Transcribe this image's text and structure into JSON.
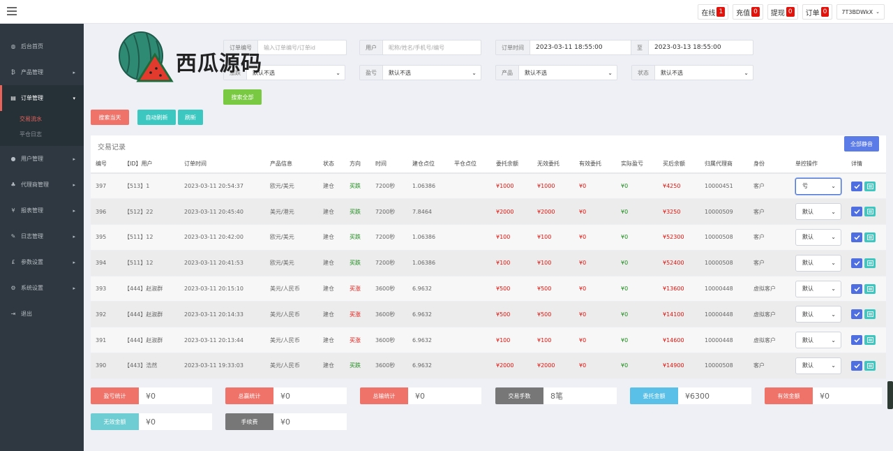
{
  "topbar": {
    "badges": [
      {
        "label": "在线",
        "count": "1"
      },
      {
        "label": "充值",
        "count": "0"
      },
      {
        "label": "提现",
        "count": "0"
      },
      {
        "label": "订单",
        "count": "0"
      }
    ],
    "user": "7T3BDWkX"
  },
  "sidebar": {
    "items": [
      {
        "label": "后台首页",
        "icon": "dashboard-icon",
        "glyph": "◍"
      },
      {
        "label": "产品管理",
        "icon": "bitcoin-icon",
        "glyph": "₿"
      },
      {
        "label": "订单管理",
        "icon": "order-icon",
        "glyph": "▤"
      },
      {
        "label": "用户管理",
        "icon": "user-icon",
        "glyph": "●"
      },
      {
        "label": "代理商管理",
        "icon": "sitemap-icon",
        "glyph": "♣"
      },
      {
        "label": "报表管理",
        "icon": "yen-icon",
        "glyph": "¥"
      },
      {
        "label": "日志管理",
        "icon": "log-icon",
        "glyph": "✎"
      },
      {
        "label": "参数设置",
        "icon": "pound-icon",
        "glyph": "£"
      },
      {
        "label": "系统设置",
        "icon": "gear-icon",
        "glyph": "⚙"
      },
      {
        "label": "退出",
        "icon": "logout-icon",
        "glyph": "⇥"
      }
    ],
    "subitems": [
      "交易流水",
      "平仓日志"
    ]
  },
  "logo": {
    "text": "西瓜源码"
  },
  "filters": {
    "order_no": {
      "label": "订单编号",
      "placeholder": "输入订单编号/订单id"
    },
    "user": {
      "label": "用户",
      "placeholder": "昵称/姓名/手机号/编号"
    },
    "order_time": {
      "label": "订单时间",
      "from": "2023-03-11 18:55:00",
      "to_label": "至",
      "to": "2023-03-13 18:55:00"
    },
    "rise_fall": {
      "label": "涨跌",
      "value": "默认不选"
    },
    "profit": {
      "label": "盈亏",
      "value": "默认不选"
    },
    "product": {
      "label": "产品",
      "value": "默认不选"
    },
    "status": {
      "label": "状态",
      "value": "默认不选"
    }
  },
  "buttons": {
    "search_all": "搜索全部",
    "search_today": "搜索当天",
    "auto_refresh": "自动刷新",
    "refresh": "刷新",
    "mute_all": "全部静音"
  },
  "table": {
    "title": "交易记录",
    "headers": [
      "编号",
      "【ID】用户",
      "订单时间",
      "产品信息",
      "状态",
      "方向",
      "时间",
      "建仓点位",
      "平仓点位",
      "委托余额",
      "无效委托",
      "有效委托",
      "实际盈亏",
      "买后余额",
      "归属代理商",
      "身份",
      "单控操作",
      "详情"
    ],
    "rows": [
      {
        "id": "397",
        "user": "【513】1",
        "time": "2023-03-11 20:54:37",
        "product": "欧元/美元",
        "status": "建仓",
        "direction": "买跌",
        "duration": "7200秒",
        "open": "1.06386",
        "close": "",
        "entrust": "¥1000",
        "invalid": "¥1000",
        "valid": "¥0",
        "pnl": "¥0",
        "balance": "¥4250",
        "agent": "10000451",
        "role": "客户",
        "control": "亏"
      },
      {
        "id": "396",
        "user": "【512】22",
        "time": "2023-03-11 20:45:40",
        "product": "美元/港元",
        "status": "建仓",
        "direction": "买跌",
        "duration": "7200秒",
        "open": "7.8464",
        "close": "",
        "entrust": "¥2000",
        "invalid": "¥2000",
        "valid": "¥0",
        "pnl": "¥0",
        "balance": "¥3250",
        "agent": "10000509",
        "role": "客户",
        "control": "默认"
      },
      {
        "id": "395",
        "user": "【511】12",
        "time": "2023-03-11 20:42:00",
        "product": "欧元/美元",
        "status": "建仓",
        "direction": "买跌",
        "duration": "7200秒",
        "open": "1.06386",
        "close": "",
        "entrust": "¥100",
        "invalid": "¥100",
        "valid": "¥0",
        "pnl": "¥0",
        "balance": "¥52300",
        "agent": "10000508",
        "role": "客户",
        "control": "默认"
      },
      {
        "id": "394",
        "user": "【511】12",
        "time": "2023-03-11 20:41:53",
        "product": "欧元/美元",
        "status": "建仓",
        "direction": "买跌",
        "duration": "7200秒",
        "open": "1.06386",
        "close": "",
        "entrust": "¥100",
        "invalid": "¥100",
        "valid": "¥0",
        "pnl": "¥0",
        "balance": "¥52400",
        "agent": "10000508",
        "role": "客户",
        "control": "默认"
      },
      {
        "id": "393",
        "user": "【444】赵淑群",
        "time": "2023-03-11 20:15:10",
        "product": "美元/人民币",
        "status": "建仓",
        "direction": "买涨",
        "duration": "3600秒",
        "open": "6.9632",
        "close": "",
        "entrust": "¥500",
        "invalid": "¥500",
        "valid": "¥0",
        "pnl": "¥0",
        "balance": "¥13600",
        "agent": "10000448",
        "role": "虚拟客户",
        "control": "默认"
      },
      {
        "id": "392",
        "user": "【444】赵淑群",
        "time": "2023-03-11 20:14:33",
        "product": "美元/人民币",
        "status": "建仓",
        "direction": "买涨",
        "duration": "3600秒",
        "open": "6.9632",
        "close": "",
        "entrust": "¥500",
        "invalid": "¥500",
        "valid": "¥0",
        "pnl": "¥0",
        "balance": "¥14100",
        "agent": "10000448",
        "role": "虚拟客户",
        "control": "默认"
      },
      {
        "id": "391",
        "user": "【444】赵淑群",
        "time": "2023-03-11 20:13:44",
        "product": "美元/人民币",
        "status": "建仓",
        "direction": "买涨",
        "duration": "3600秒",
        "open": "6.9632",
        "close": "",
        "entrust": "¥100",
        "invalid": "¥100",
        "valid": "¥0",
        "pnl": "¥0",
        "balance": "¥14600",
        "agent": "10000448",
        "role": "虚拟客户",
        "control": "默认"
      },
      {
        "id": "390",
        "user": "【443】浩然",
        "time": "2023-03-11 19:33:03",
        "product": "美元/人民币",
        "status": "建仓",
        "direction": "买跌",
        "duration": "3600秒",
        "open": "6.9632",
        "close": "",
        "entrust": "¥2000",
        "invalid": "¥2000",
        "valid": "¥0",
        "pnl": "¥0",
        "balance": "¥14900",
        "agent": "10000508",
        "role": "客户",
        "control": "默认"
      }
    ]
  },
  "stats": [
    {
      "label": "盈亏统计",
      "value": "¥0",
      "color": "#f0736a"
    },
    {
      "label": "总赢统计",
      "value": "¥0",
      "color": "#f0736a"
    },
    {
      "label": "总输统计",
      "value": "¥0",
      "color": "#f0736a"
    },
    {
      "label": "交易手数",
      "value": "8笔",
      "color": "#777777"
    },
    {
      "label": "委托金额",
      "value": "¥6300",
      "color": "#5bc0e8"
    },
    {
      "label": "有效金额",
      "value": "¥0",
      "color": "#f0736a"
    },
    {
      "label": "无效金额",
      "value": "¥0",
      "color": "#6dcdd2"
    },
    {
      "label": "手续费",
      "value": "¥0",
      "color": "#777777"
    }
  ],
  "colors": {
    "accent_red": "#f0736a",
    "teal": "#3cc8c0",
    "green_btn": "#7ac943",
    "blue_btn": "#5b7be6",
    "sidebar_bg": "#2f3840"
  }
}
